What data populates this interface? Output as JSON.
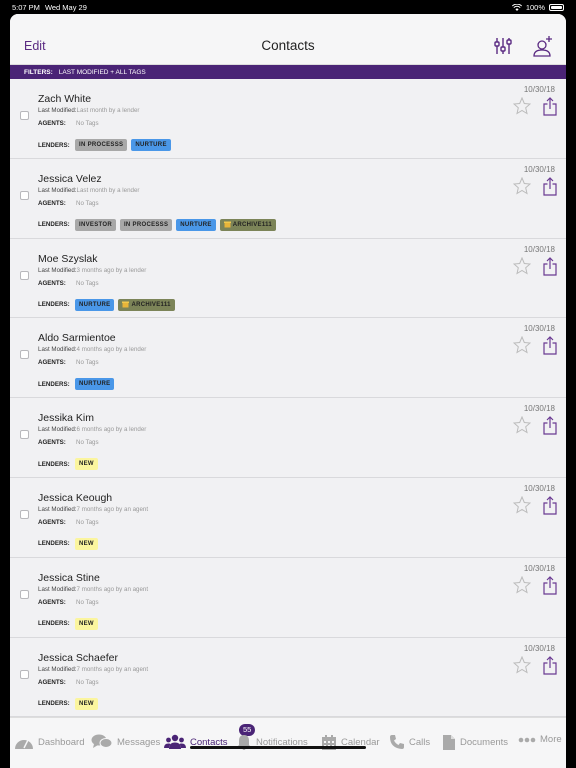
{
  "status_bar": {
    "time": "5:07 PM",
    "date": "Wed May 29",
    "battery": "100%"
  },
  "navbar": {
    "edit_label": "Edit",
    "title": "Contacts"
  },
  "filters": {
    "label": "FILTERS:",
    "value": "LAST MODIFIED + ALL TAGS"
  },
  "labels": {
    "last_modified": "Last Modified:",
    "agents": "AGENTS:",
    "lenders": "LENDERS:"
  },
  "contacts": [
    {
      "name": "Zach White",
      "modified": "Last month by a lender",
      "agents": "No Tags",
      "date": "10/30/18",
      "tags": [
        {
          "label": "IN PROCESSS",
          "color": "grey"
        },
        {
          "label": "NURTURE",
          "color": "blue"
        }
      ]
    },
    {
      "name": "Jessica Velez",
      "modified": "Last month by a lender",
      "agents": "No Tags",
      "date": "10/30/18",
      "tags": [
        {
          "label": "INVESTOR",
          "color": "grey"
        },
        {
          "label": "IN PROCESSS",
          "color": "grey"
        },
        {
          "label": "NURTURE",
          "color": "blue"
        },
        {
          "label": "ARCHIVE111",
          "color": "olive",
          "icon": true
        }
      ]
    },
    {
      "name": "Moe Szyslak",
      "modified": "3 months ago by a lender",
      "agents": "No Tags",
      "date": "10/30/18",
      "tags": [
        {
          "label": "NURTURE",
          "color": "blue"
        },
        {
          "label": "ARCHIVE111",
          "color": "olive",
          "icon": true
        }
      ]
    },
    {
      "name": "Aldo Sarmientoe",
      "modified": "4 months ago by a lender",
      "agents": "No Tags",
      "date": "10/30/18",
      "tags": [
        {
          "label": "NURTURE",
          "color": "blue"
        }
      ]
    },
    {
      "name": "Jessika Kim",
      "modified": "6 months ago by a lender",
      "agents": "No Tags",
      "date": "10/30/18",
      "tags": [
        {
          "label": "NEW",
          "color": "yellow"
        }
      ]
    },
    {
      "name": "Jessica Keough",
      "modified": "7 months ago by an agent",
      "agents": "No Tags",
      "date": "10/30/18",
      "tags": [
        {
          "label": "NEW",
          "color": "yellow"
        }
      ]
    },
    {
      "name": "Jessica Stine",
      "modified": "7 months ago by an agent",
      "agents": "No Tags",
      "date": "10/30/18",
      "tags": [
        {
          "label": "NEW",
          "color": "yellow"
        }
      ]
    },
    {
      "name": "Jessica Schaefer",
      "modified": "7 months ago by an agent",
      "agents": "No Tags",
      "date": "10/30/18",
      "tags": [
        {
          "label": "NEW",
          "color": "yellow"
        }
      ]
    }
  ],
  "tabbar": {
    "dashboard": "Dashboard",
    "messages": "Messages",
    "contacts": "Contacts",
    "notifications": "Notifications",
    "notifications_badge": "55",
    "calendar": "Calendar",
    "calls": "Calls",
    "documents": "Documents",
    "more": "More"
  },
  "colors": {
    "accent": "#4a2476",
    "tag_grey": "#a8a8a8",
    "tag_blue": "#4a97e8",
    "tag_yellow": "#fbf59e",
    "tag_olive": "#7c8458"
  }
}
